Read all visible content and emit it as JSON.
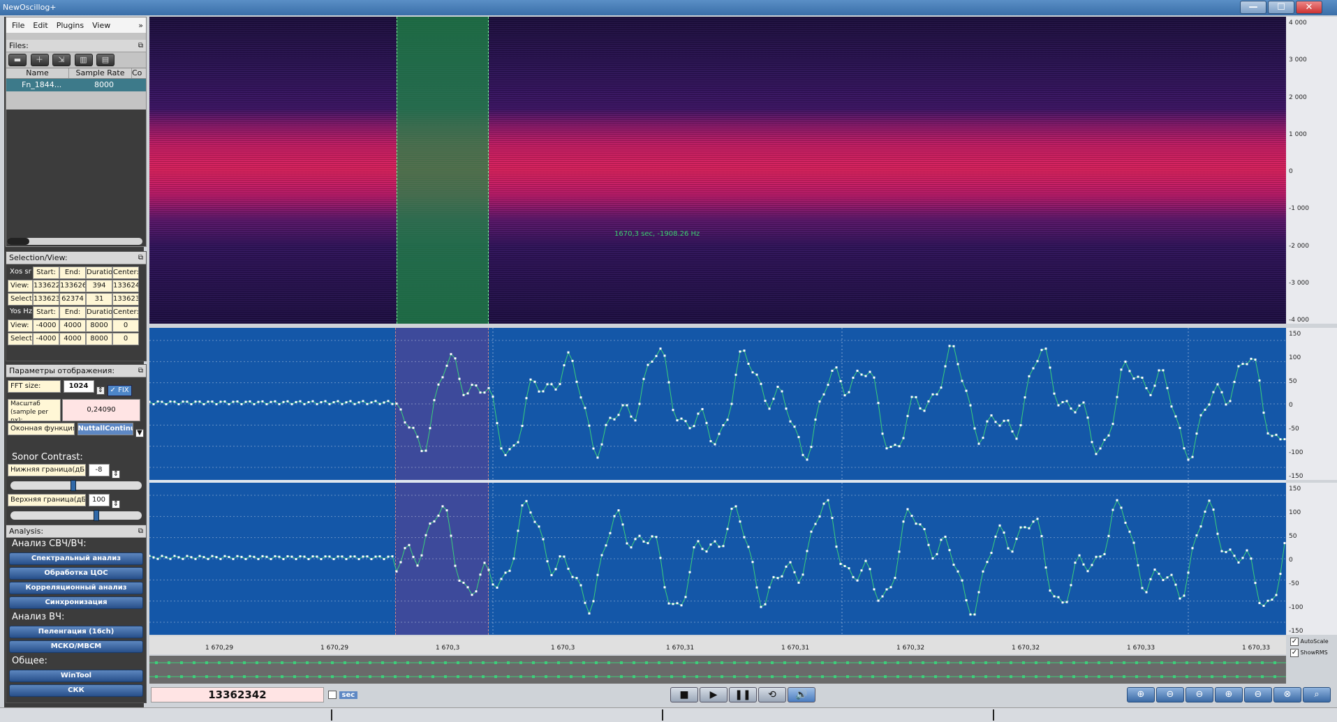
{
  "window": {
    "title": "NewOscillog+",
    "min": "—",
    "max": "☐",
    "close": "✕"
  },
  "menu": [
    "File",
    "Edit",
    "Plugins",
    "View",
    "»"
  ],
  "files": {
    "header": "Files:",
    "columns": [
      "Name",
      "Sample Rate",
      "Co"
    ],
    "rows": [
      {
        "name": "Fn_1844...",
        "rate": "8000"
      }
    ]
  },
  "selection": {
    "header": "Selection/View:",
    "xos_label": "Xos sr",
    "cols": [
      "Start:",
      "End:",
      "Duratio",
      "Center:"
    ],
    "x_view": {
      "label": "View:",
      "start": "133622",
      "end": "133626",
      "dur": "394",
      "center": "133624"
    },
    "x_sel": {
      "label": "Selectio",
      "start": "133623",
      "end": "62374",
      "dur": "31",
      "center": "133623"
    },
    "yos_label": "Yos Hz",
    "y_view": {
      "label": "View:",
      "start": "-4000",
      "end": "4000",
      "dur": "8000",
      "center": "0"
    },
    "y_sel": {
      "label": "Selectio",
      "start": "-4000",
      "end": "4000",
      "dur": "8000",
      "center": "0"
    }
  },
  "display": {
    "header": "Параметры отображения:",
    "fft_label": "FFT size:",
    "fft_value": "1024",
    "fix_label": "FIX",
    "scale_label": "Масштаб (sample per px):",
    "scale_value": "0,24090",
    "window_label": "Оконная функция:",
    "window_value": "NuttallContinu"
  },
  "sonor": {
    "title": "Sonor Contrast:",
    "low_label": "Нижняя граница(дБ)",
    "low_value": "-8",
    "high_label": "Верхняя граница(дБ)",
    "high_value": "100",
    "low_level": 0.48,
    "high_level": 0.66
  },
  "analysis": {
    "header": "Analysis:",
    "g1": "Анализ СВЧ/ВЧ:",
    "g1_items": [
      "Спектральный анализ",
      "Обработка ЦОС",
      "Корреляционный анализ",
      "Синхронизация"
    ],
    "g2": "Анализ ВЧ:",
    "g2_items": [
      "Пеленгация (16ch)",
      "МСКО/МВСМ"
    ],
    "g3": "Общее:",
    "g3_items": [
      "WinTool",
      "СКК"
    ]
  },
  "spectrogram": {
    "readout": "1670,3 sec, -1908.26 Hz",
    "y_ticks": [
      "4 000",
      "3 000",
      "2 000",
      "1 000",
      "0",
      "-1 000",
      "-2 000",
      "-3 000",
      "-4 000"
    ]
  },
  "osc_ticks": [
    "150",
    "100",
    "50",
    "0",
    "-50",
    "-100",
    "-150"
  ],
  "x_ticks": [
    "1 670,29",
    "1 670,29",
    "1 670,3",
    "1 670,3",
    "1 670,31",
    "1 670,31",
    "1 670,32",
    "1 670,32",
    "1 670,33",
    "1 670,33"
  ],
  "options": [
    "AutoScale",
    "ShowRMS"
  ],
  "bottom": {
    "position": "13362342",
    "sec_label": "sec"
  }
}
